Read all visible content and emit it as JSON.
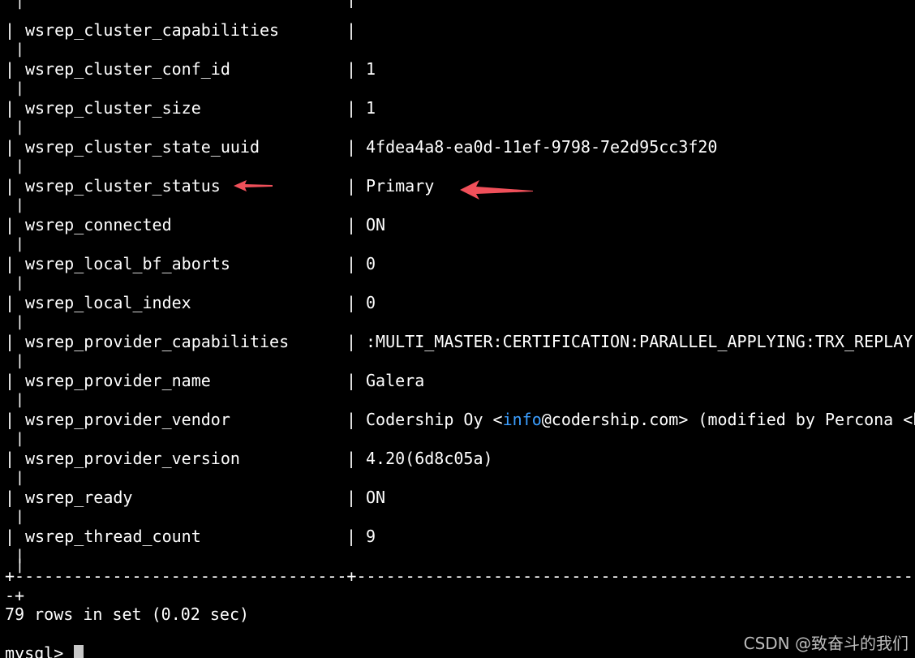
{
  "terminal": {
    "top_partial": {
      "bar": "|",
      "mid_bar": "|"
    },
    "rows": [
      {
        "name": "wsrep_cluster_capabilities",
        "value": ""
      },
      {
        "name": "wsrep_cluster_conf_id",
        "value": "1"
      },
      {
        "name": "wsrep_cluster_size",
        "value": "1"
      },
      {
        "name": "wsrep_cluster_state_uuid",
        "value": "4fdea4a8-ea0d-11ef-9798-7e2d95cc3f20"
      },
      {
        "name": "wsrep_cluster_status",
        "value": "Primary"
      },
      {
        "name": "wsrep_connected",
        "value": "ON"
      },
      {
        "name": "wsrep_local_bf_aborts",
        "value": "0"
      },
      {
        "name": "wsrep_local_index",
        "value": "0"
      },
      {
        "name": "wsrep_provider_capabilities",
        "value": ":MULTI_MASTER:CERTIFICATION:PARALLEL_APPLYING:TRX_REPLAY:"
      },
      {
        "name": "wsrep_provider_name",
        "value": "Galera"
      },
      {
        "name": "wsrep_provider_vendor",
        "value_pre": "Codership Oy <",
        "value_link": "info",
        "value_post": "@codership.com> (modified by Percona <h"
      },
      {
        "name": "wsrep_provider_version",
        "value": "4.20(6d8c05a)"
      },
      {
        "name": "wsrep_ready",
        "value": "ON"
      },
      {
        "name": "wsrep_thread_count",
        "value": "9"
      }
    ],
    "separator": "+----------------------------------+-----------------------------------------------------------------------------",
    "separator_wrap": "-+",
    "result_line": "79 rows in set (0.02 sec)",
    "prompt": "mysql> ",
    "bar": "|"
  },
  "watermark": "CSDN @致奋斗的我们",
  "annotation_color": "#f0505a"
}
